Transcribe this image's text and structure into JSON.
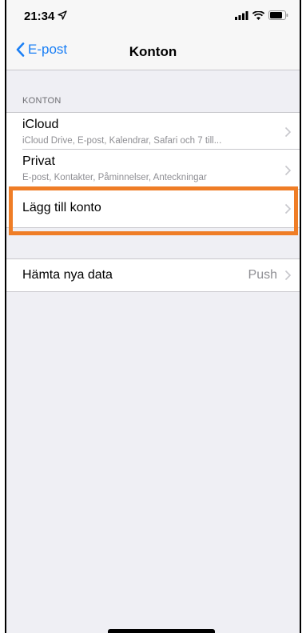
{
  "status_bar": {
    "time": "21:34",
    "icons": [
      "location-arrow-icon",
      "signal-bars-icon",
      "wifi-icon",
      "battery-icon"
    ]
  },
  "nav": {
    "back_label": "E-post",
    "title": "Konton"
  },
  "accounts_section": {
    "header": "KONTON",
    "items": [
      {
        "title": "iCloud",
        "subtitle": "iCloud Drive, E-post, Kalendrar, Safari och 7 till..."
      },
      {
        "title": "Privat",
        "subtitle": "E-post, Kontakter, Påminnelser, Anteckningar"
      },
      {
        "title": "Lägg till konto"
      }
    ]
  },
  "fetch_section": {
    "label": "Hämta nya data",
    "value": "Push"
  },
  "colors": {
    "accent": "#1a7ff5",
    "highlight": "#ef7d26",
    "background": "#efeff4"
  }
}
